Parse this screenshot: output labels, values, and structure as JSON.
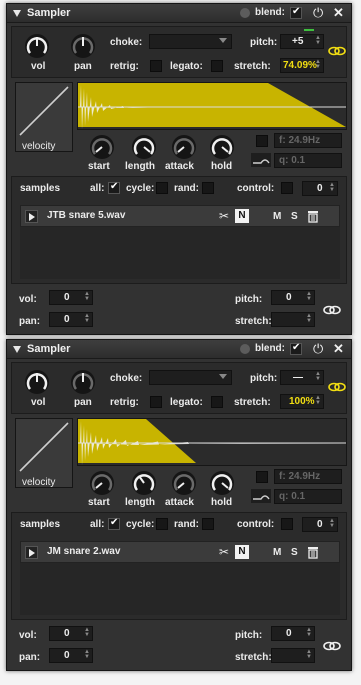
{
  "panels": [
    {
      "title": "Sampler",
      "blend_label": "blend:",
      "choke_label": "choke:",
      "choke_value": "",
      "pitch_label": "pitch:",
      "pitch_value": "+5",
      "retrig_label": "retrig:",
      "legato_label": "legato:",
      "stretch_label": "stretch:",
      "stretch_value": "74.09%",
      "vol_label": "vol",
      "pan_label": "pan",
      "velocity_label": "velocity",
      "start_label": "start",
      "length_label": "length",
      "attack_label": "attack",
      "hold_label": "hold",
      "f_value": "f: 24.9Hz",
      "q_value": "q: 0.1",
      "samples_label": "samples",
      "all_label": "all:",
      "cycle_label": "cycle:",
      "rand_label": "rand:",
      "control_label": "control:",
      "control_value": "0",
      "sample_name": "JTB snare 5.wav",
      "n_label": "N",
      "m_label": "M",
      "s_label": "S",
      "bottom_vol_label": "vol:",
      "bottom_vol_value": "0",
      "bottom_pan_label": "pan:",
      "bottom_pan_value": "0",
      "bottom_pitch_label": "pitch:",
      "bottom_pitch_value": "0",
      "bottom_stretch_label": "stretch:",
      "bottom_stretch_value": ""
    },
    {
      "title": "Sampler",
      "blend_label": "blend:",
      "choke_label": "choke:",
      "choke_value": "",
      "pitch_label": "pitch:",
      "pitch_value": "—",
      "retrig_label": "retrig:",
      "legato_label": "legato:",
      "stretch_label": "stretch:",
      "stretch_value": "100%",
      "vol_label": "vol",
      "pan_label": "pan",
      "velocity_label": "velocity",
      "start_label": "start",
      "length_label": "length",
      "attack_label": "attack",
      "hold_label": "hold",
      "f_value": "f: 24.9Hz",
      "q_value": "q: 0.1",
      "samples_label": "samples",
      "all_label": "all:",
      "cycle_label": "cycle:",
      "rand_label": "rand:",
      "control_label": "control:",
      "control_value": "0",
      "sample_name": "JM snare 2.wav",
      "n_label": "N",
      "m_label": "M",
      "s_label": "S",
      "bottom_vol_label": "vol:",
      "bottom_vol_value": "0",
      "bottom_pan_label": "pan:",
      "bottom_pan_value": "0",
      "bottom_pitch_label": "pitch:",
      "bottom_pitch_value": "0",
      "bottom_stretch_label": "stretch:",
      "bottom_stretch_value": ""
    }
  ],
  "colors": {
    "accent_yellow": "#f2de12",
    "waveform_fill": "#c8b400",
    "panel_bg": "#323232"
  },
  "icons": [
    "collapse-triangle-icon",
    "blend-dot-icon",
    "checkmark-icon",
    "power-icon",
    "close-icon",
    "dropdown-arrow-icon",
    "link-chain-icon",
    "play-icon",
    "scissors-icon",
    "trash-icon",
    "filter-curve-icon"
  ]
}
